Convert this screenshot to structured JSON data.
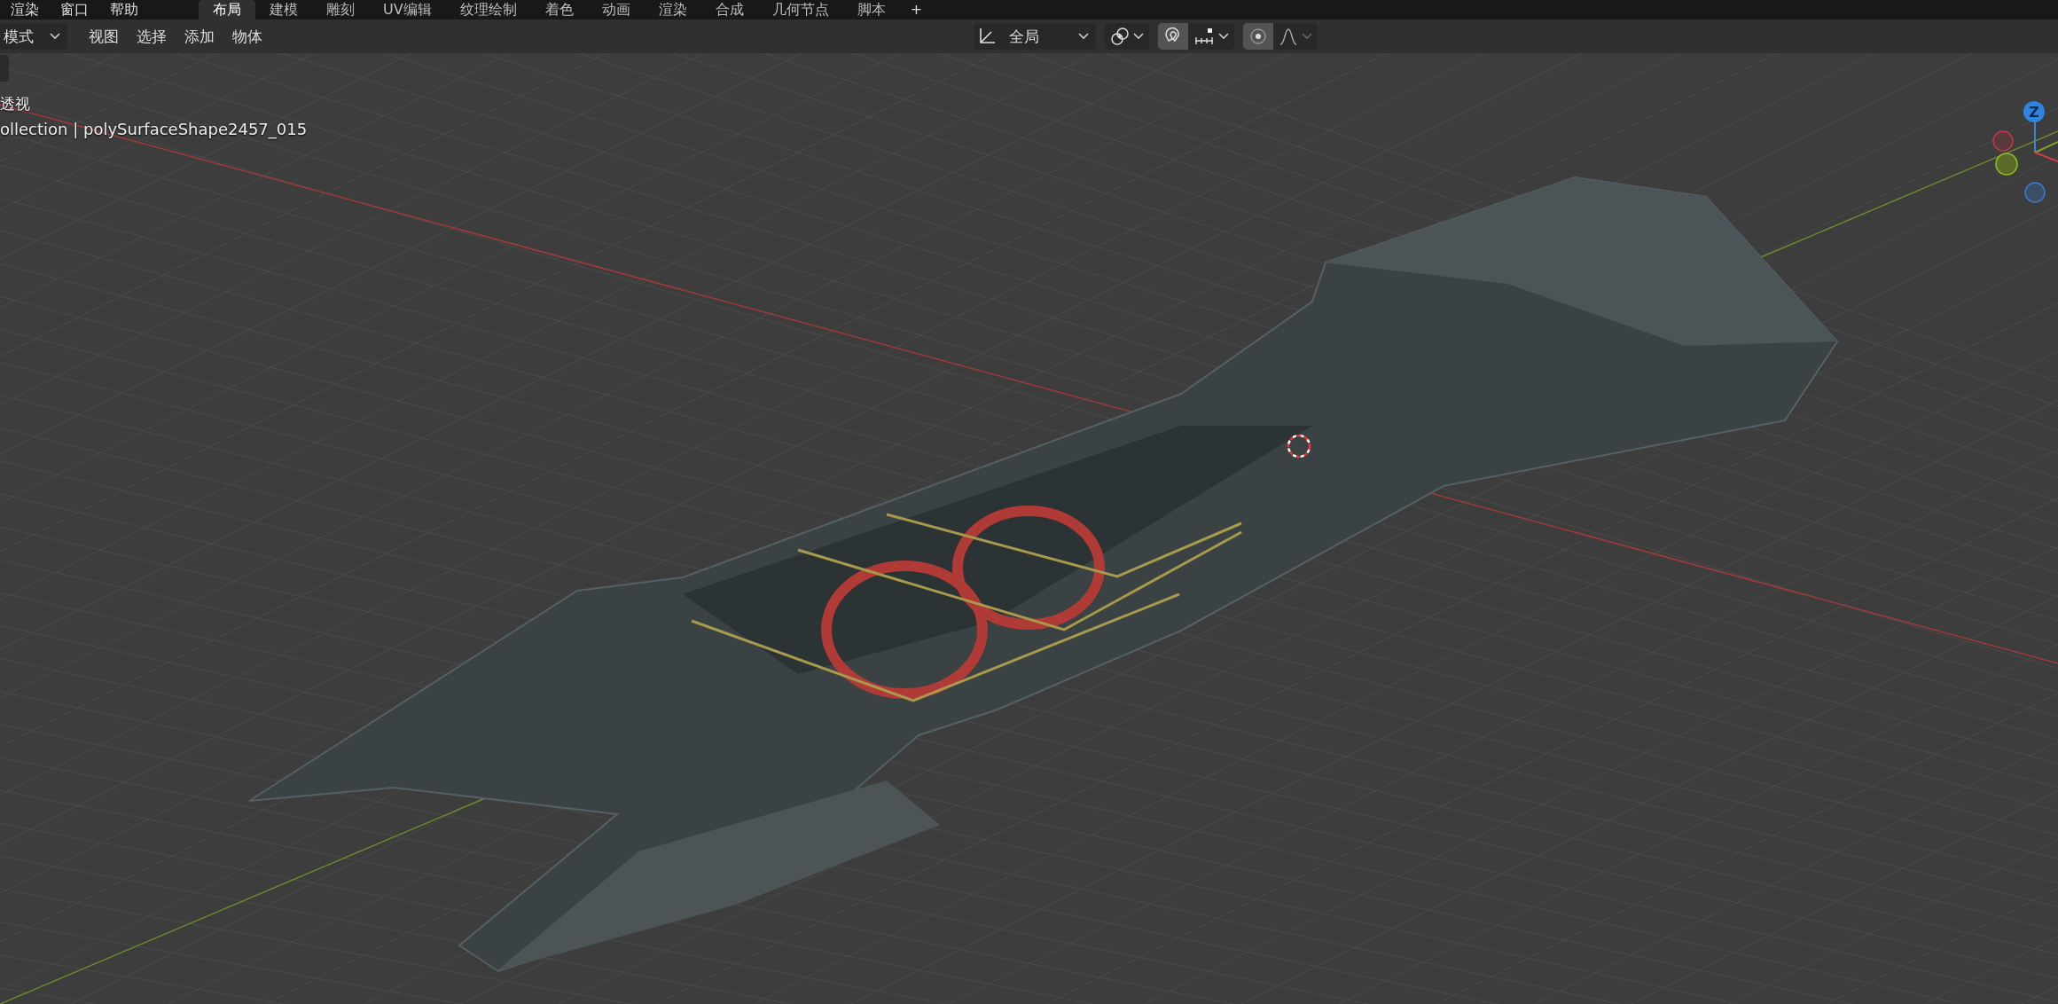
{
  "top_menu": [
    "渲染",
    "窗口",
    "帮助"
  ],
  "workspace_tabs": [
    {
      "label": "布局",
      "selected": true
    },
    {
      "label": "建模",
      "selected": false
    },
    {
      "label": "雕刻",
      "selected": false
    },
    {
      "label": "UV编辑",
      "selected": false
    },
    {
      "label": "纹理绘制",
      "selected": false
    },
    {
      "label": "着色",
      "selected": false
    },
    {
      "label": "动画",
      "selected": false
    },
    {
      "label": "渲染",
      "selected": false
    },
    {
      "label": "合成",
      "selected": false
    },
    {
      "label": "几何节点",
      "selected": false
    },
    {
      "label": "脚本",
      "selected": false
    }
  ],
  "add_tab_button": "+",
  "header": {
    "mode_dropdown": "模式",
    "menus": [
      "视图",
      "选择",
      "添加",
      "物体"
    ],
    "transform_orientation": "全局",
    "snapping_on": true,
    "proportional_editing_on": true
  },
  "viewport": {
    "view_name": "透视",
    "object_info": "ollection | polySurfaceShape2457_015"
  },
  "gizmo": {
    "z_label": "Z"
  }
}
